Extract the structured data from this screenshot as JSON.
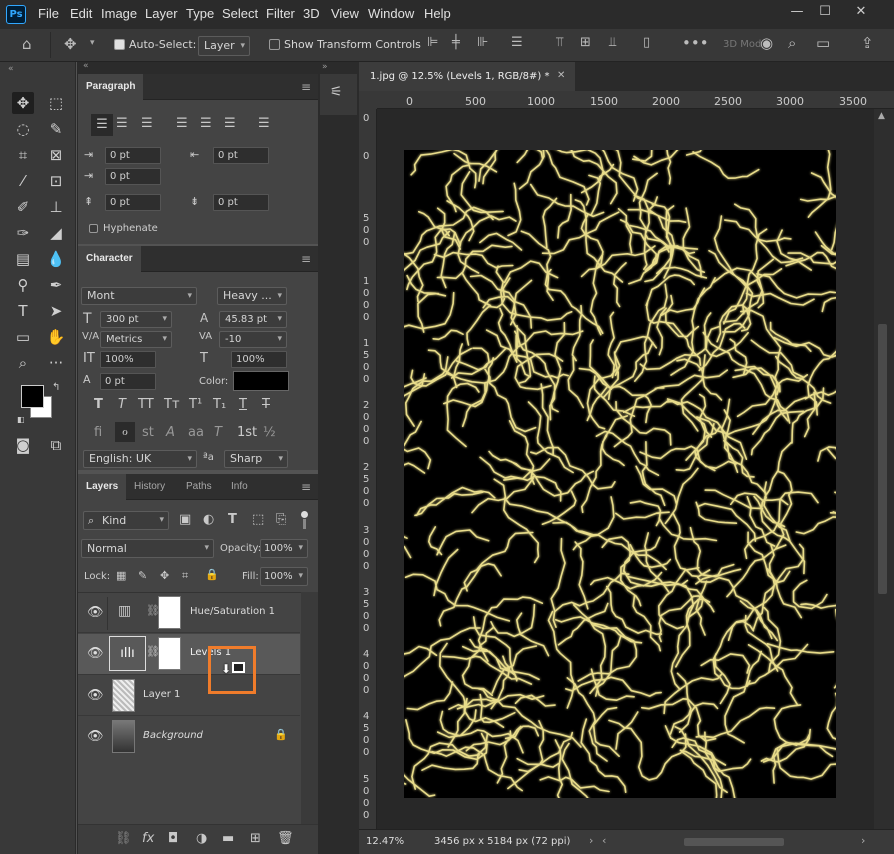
{
  "menubar": {
    "logo": "Ps",
    "items": [
      "File",
      "Edit",
      "Image",
      "Layer",
      "Type",
      "Select",
      "Filter",
      "3D",
      "View",
      "Window",
      "Help"
    ]
  },
  "options": {
    "auto_select_label": "Auto-Select:",
    "auto_select_target": "Layer",
    "show_transform_label": "Show Transform Controls",
    "mode_3d_label": "3D Mod"
  },
  "paragraph": {
    "title": "Paragraph",
    "indent_left": "0 pt",
    "indent_right": "0 pt",
    "indent_first": "0 pt",
    "space_before": "0 pt",
    "space_after": "0 pt",
    "hyphenate_label": "Hyphenate"
  },
  "character": {
    "title": "Character",
    "font_family": "Mont",
    "font_style": "Heavy ...",
    "font_size": "300 pt",
    "leading": "45.83 pt",
    "kerning": "Metrics",
    "tracking": "-10",
    "vertical_scale": "100%",
    "horizontal_scale": "100%",
    "baseline_shift": "0 pt",
    "color_label": "Color:",
    "language": "English: UK",
    "aa_label": "ªa",
    "antialias": "Sharp"
  },
  "layers_panel": {
    "tabs": [
      "Layers",
      "History",
      "Paths",
      "Info"
    ],
    "filter_label": "Kind",
    "blend_mode": "Normal",
    "opacity_label": "Opacity:",
    "opacity_value": "100%",
    "lock_label": "Lock:",
    "fill_label": "Fill:",
    "fill_value": "100%",
    "layers": [
      {
        "name": "Hue/Saturation 1"
      },
      {
        "name": "Levels 1"
      },
      {
        "name": "Layer 1"
      },
      {
        "name": "Background"
      }
    ]
  },
  "document": {
    "tab_title": "1.jpg @ 12.5% (Levels 1, RGB/8#) *",
    "ruler_labels": [
      "0",
      "500",
      "1000",
      "1500",
      "2000",
      "2500",
      "3000",
      "3500"
    ],
    "vruler_labels": [
      "0",
      "0",
      "5\n0\n0",
      "1\n0\n0\n0",
      "1\n5\n0\n0",
      "2\n0\n0\n0",
      "2\n5\n0\n0",
      "3\n0\n0\n0",
      "3\n5\n0\n0",
      "4\n0\n0\n0",
      "4\n5\n0\n0",
      "5\n0\n0\n0"
    ],
    "zoom": "12.47%",
    "dimensions": "3456 px x 5184 px (72 ppi)"
  },
  "colors": {
    "accent": "#f07c2b",
    "fg": "#000000",
    "bg": "#ffffff",
    "gold": "#e8dc8a"
  }
}
